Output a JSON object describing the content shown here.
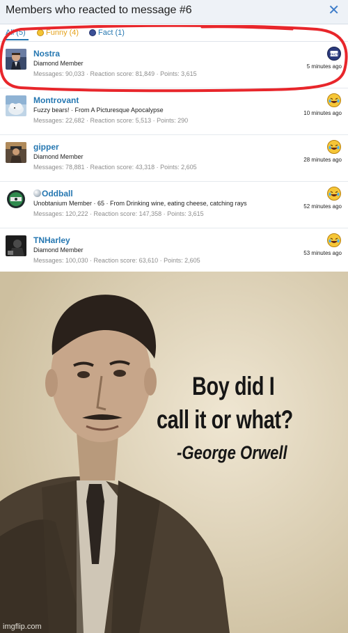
{
  "dialog": {
    "title": "Members who reacted to message #6",
    "close_glyph": "✕",
    "tabs": [
      {
        "label": "All (5)",
        "icon": ""
      },
      {
        "label": "Funny (4)",
        "icon": "laughing-face-icon"
      },
      {
        "label": "Fact (1)",
        "icon": "fact-icon"
      }
    ],
    "members": [
      {
        "name": "Nostra",
        "title": "Diamond Member",
        "stats": "Messages: 90,033 · Reaction score: 81,849 · Points: 3,615",
        "reaction": "fact-icon",
        "time": "5 minutes ago"
      },
      {
        "name": "Montrovant",
        "title": "Fuzzy bears! · From A Picturesque Apocalypse",
        "stats": "Messages: 22,682 · Reaction score: 5,513 · Points: 290",
        "reaction": "laughing-face-icon",
        "time": "10 minutes ago"
      },
      {
        "name": "gipper",
        "title": "Diamond Member",
        "stats": "Messages: 78,881 · Reaction score: 43,318 · Points: 2,605",
        "reaction": "laughing-face-icon",
        "time": "28 minutes ago"
      },
      {
        "name": "Oddball",
        "title": "Unobtanium Member · 65 · From Drinking wine, eating cheese, catching rays",
        "stats": "Messages: 120,222 · Reaction score: 147,358 · Points: 3,615",
        "reaction": "laughing-face-icon",
        "time": "52 minutes ago"
      },
      {
        "name": "TNHarley",
        "title": "Diamond Member",
        "stats": "Messages: 100,030 · Reaction score: 63,610 · Points: 2,605",
        "reaction": "laughing-face-icon",
        "time": "53 minutes ago"
      }
    ],
    "highlight_color": "#e8262b",
    "accent_color": "#2577b1"
  },
  "meme": {
    "line1": "Boy did I",
    "line2": "call it or what?",
    "line3": "-George Orwell",
    "watermark": "imgflip.com"
  }
}
